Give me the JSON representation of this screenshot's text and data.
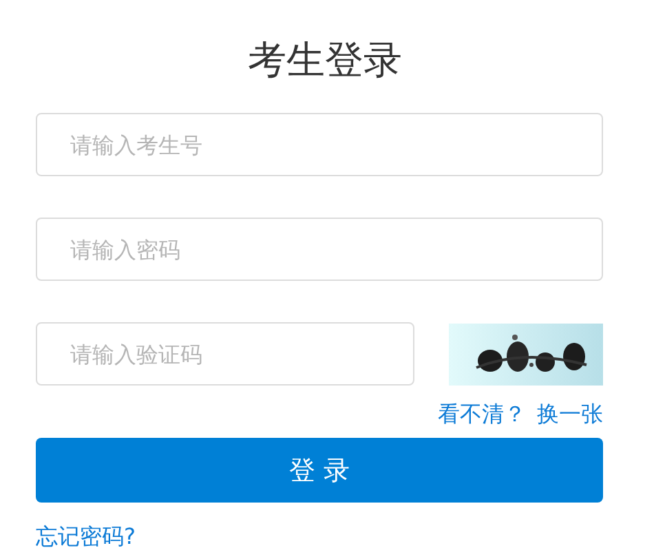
{
  "title": "考生登录",
  "fields": [
    {
      "placeholder": "请输入考生号"
    },
    {
      "placeholder": "请输入密码"
    }
  ],
  "captcha": {
    "placeholder": "请输入验证码"
  },
  "captcha_links": [
    "看不清？",
    "换一张"
  ],
  "login_button": "登 录",
  "forgot_link": "忘记密码?"
}
